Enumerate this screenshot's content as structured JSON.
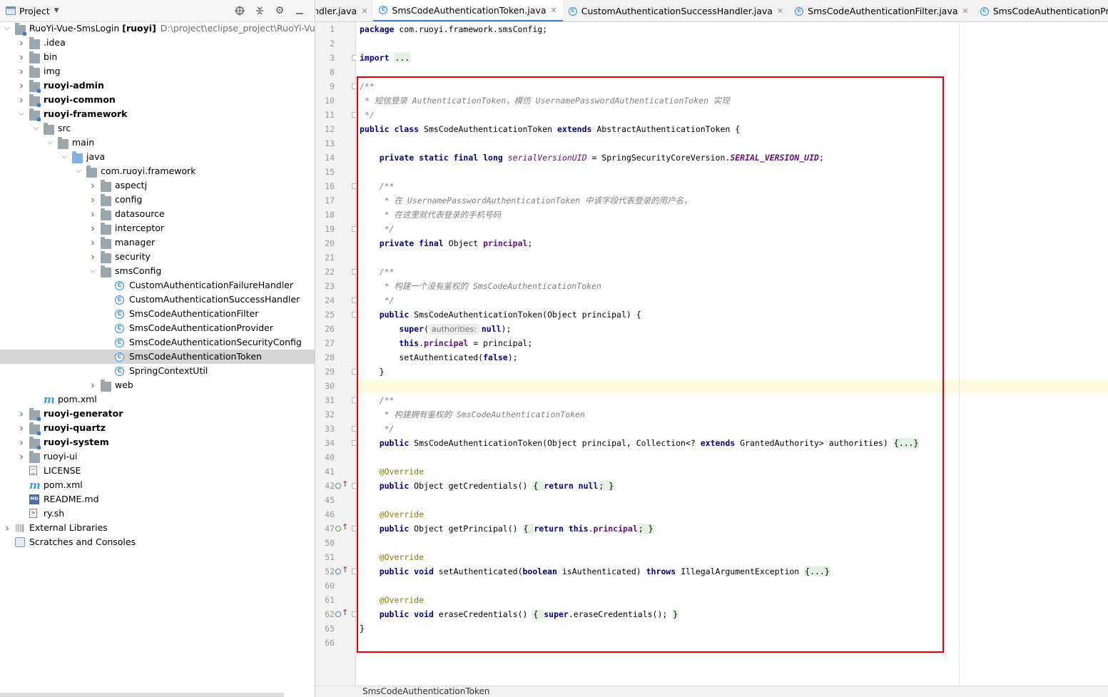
{
  "project_panel": {
    "title": "Project",
    "tools": [
      "locate-icon",
      "collapse-icon",
      "gear-icon",
      "hide-icon"
    ]
  },
  "tree": [
    {
      "label": "RuoYi-Vue-SmsLogin [ruoyi]",
      "path": "D:\\project\\eclipse_project\\RuoYi-Vue-Sm",
      "depth": 0,
      "arrow": "down",
      "icon": "module",
      "bold": false
    },
    {
      "label": ".idea",
      "depth": 1,
      "arrow": "right",
      "icon": "folder"
    },
    {
      "label": "bin",
      "depth": 1,
      "arrow": "right",
      "icon": "folder"
    },
    {
      "label": "img",
      "depth": 1,
      "arrow": "right",
      "icon": "folder"
    },
    {
      "label": "ruoyi-admin",
      "depth": 1,
      "arrow": "right",
      "icon": "module",
      "bold": true
    },
    {
      "label": "ruoyi-common",
      "depth": 1,
      "arrow": "right",
      "icon": "module",
      "bold": true
    },
    {
      "label": "ruoyi-framework",
      "depth": 1,
      "arrow": "down",
      "icon": "module",
      "bold": true
    },
    {
      "label": "src",
      "depth": 2,
      "arrow": "down",
      "icon": "folder"
    },
    {
      "label": "main",
      "depth": 3,
      "arrow": "down",
      "icon": "folder"
    },
    {
      "label": "java",
      "depth": 4,
      "arrow": "down",
      "icon": "folder-blue"
    },
    {
      "label": "com.ruoyi.framework",
      "depth": 5,
      "arrow": "down",
      "icon": "folder"
    },
    {
      "label": "aspectj",
      "depth": 6,
      "arrow": "right",
      "icon": "folder"
    },
    {
      "label": "config",
      "depth": 6,
      "arrow": "right",
      "icon": "folder"
    },
    {
      "label": "datasource",
      "depth": 6,
      "arrow": "right",
      "icon": "folder"
    },
    {
      "label": "interceptor",
      "depth": 6,
      "arrow": "right",
      "icon": "folder"
    },
    {
      "label": "manager",
      "depth": 6,
      "arrow": "right",
      "icon": "folder"
    },
    {
      "label": "security",
      "depth": 6,
      "arrow": "right",
      "icon": "folder"
    },
    {
      "label": "smsConfig",
      "depth": 6,
      "arrow": "down",
      "icon": "folder"
    },
    {
      "label": "CustomAuthenticationFailureHandler",
      "depth": 7,
      "arrow": "",
      "icon": "class"
    },
    {
      "label": "CustomAuthenticationSuccessHandler",
      "depth": 7,
      "arrow": "",
      "icon": "class"
    },
    {
      "label": "SmsCodeAuthenticationFilter",
      "depth": 7,
      "arrow": "",
      "icon": "class"
    },
    {
      "label": "SmsCodeAuthenticationProvider",
      "depth": 7,
      "arrow": "",
      "icon": "class"
    },
    {
      "label": "SmsCodeAuthenticationSecurityConfig",
      "depth": 7,
      "arrow": "",
      "icon": "class"
    },
    {
      "label": "SmsCodeAuthenticationToken",
      "depth": 7,
      "arrow": "",
      "icon": "class",
      "selected": true
    },
    {
      "label": "SpringContextUtil",
      "depth": 7,
      "arrow": "",
      "icon": "class"
    },
    {
      "label": "web",
      "depth": 6,
      "arrow": "right",
      "icon": "folder"
    },
    {
      "label": "pom.xml",
      "depth": 2,
      "arrow": "",
      "icon": "maven"
    },
    {
      "label": "ruoyi-generator",
      "depth": 1,
      "arrow": "right",
      "icon": "module",
      "bold": true
    },
    {
      "label": "ruoyi-quartz",
      "depth": 1,
      "arrow": "right",
      "icon": "module",
      "bold": true
    },
    {
      "label": "ruoyi-system",
      "depth": 1,
      "arrow": "right",
      "icon": "module",
      "bold": true
    },
    {
      "label": "ruoyi-ui",
      "depth": 1,
      "arrow": "right",
      "icon": "folder"
    },
    {
      "label": "LICENSE",
      "depth": 1,
      "arrow": "",
      "icon": "file"
    },
    {
      "label": "pom.xml",
      "depth": 1,
      "arrow": "",
      "icon": "maven"
    },
    {
      "label": "README.md",
      "depth": 1,
      "arrow": "",
      "icon": "md"
    },
    {
      "label": "ry.sh",
      "depth": 1,
      "arrow": "",
      "icon": "sh"
    },
    {
      "label": "External Libraries",
      "depth": 0,
      "arrow": "right",
      "icon": "library"
    },
    {
      "label": "Scratches and Consoles",
      "depth": 0,
      "arrow": "",
      "icon": "scratch"
    }
  ],
  "tabs": [
    {
      "label": "ndler.java",
      "partial": true,
      "icon": false
    },
    {
      "label": "SmsCodeAuthenticationToken.java",
      "active": true,
      "icon": true
    },
    {
      "label": "CustomAuthenticationSuccessHandler.java",
      "icon": true
    },
    {
      "label": "SmsCodeAuthenticationFilter.java",
      "icon": true
    },
    {
      "label": "SmsCodeAuthenticationProvider.java",
      "icon": true,
      "noclose": true
    }
  ],
  "code_lines": [
    {
      "n": "1",
      "tokens": [
        [
          "k",
          "package"
        ],
        [
          "t",
          " com.ruoyi.framework.smsConfig;"
        ]
      ]
    },
    {
      "n": "2",
      "tokens": []
    },
    {
      "n": "3",
      "fold": true,
      "tokens": [
        [
          "k",
          "import"
        ],
        [
          "t",
          " "
        ],
        [
          "fd",
          "..."
        ]
      ]
    },
    {
      "n": "8",
      "tokens": []
    },
    {
      "n": "9",
      "fold": true,
      "tokens": [
        [
          "c",
          "/**"
        ]
      ]
    },
    {
      "n": "10",
      "tokens": [
        [
          "c",
          " * 短信登录 AuthenticationToken，模仿 UsernamePasswordAuthenticationToken 实现"
        ]
      ]
    },
    {
      "n": "11",
      "fold": true,
      "tokens": [
        [
          "c",
          " */"
        ]
      ]
    },
    {
      "n": "12",
      "tokens": [
        [
          "k",
          "public class"
        ],
        [
          "t",
          " SmsCodeAuthenticationToken "
        ],
        [
          "k",
          "extends"
        ],
        [
          "t",
          " AbstractAuthenticationToken {"
        ]
      ]
    },
    {
      "n": "13",
      "tokens": []
    },
    {
      "n": "14",
      "tokens": [
        [
          "t",
          "    "
        ],
        [
          "k",
          "private static final long"
        ],
        [
          "t",
          " "
        ],
        [
          "fi",
          "serialVersionUID"
        ],
        [
          "t",
          " = SpringSecurityCoreVersion."
        ],
        [
          "sf",
          "SERIAL_VERSION_UID"
        ],
        [
          "t",
          ";"
        ]
      ]
    },
    {
      "n": "15",
      "tokens": []
    },
    {
      "n": "16",
      "fold": true,
      "tokens": [
        [
          "t",
          "    "
        ],
        [
          "c",
          "/**"
        ]
      ]
    },
    {
      "n": "17",
      "tokens": [
        [
          "t",
          "     "
        ],
        [
          "c",
          "* 在 UsernamePasswordAuthenticationToken 中该字段代表登录的用户名，"
        ]
      ]
    },
    {
      "n": "18",
      "tokens": [
        [
          "t",
          "     "
        ],
        [
          "c",
          "* 在这里就代表登录的手机号码"
        ]
      ]
    },
    {
      "n": "19",
      "fold": true,
      "tokens": [
        [
          "t",
          "     "
        ],
        [
          "c",
          "*/"
        ]
      ]
    },
    {
      "n": "20",
      "tokens": [
        [
          "t",
          "    "
        ],
        [
          "k",
          "private final"
        ],
        [
          "t",
          " Object "
        ],
        [
          "f",
          "principal"
        ],
        [
          "t",
          ";"
        ]
      ]
    },
    {
      "n": "21",
      "tokens": []
    },
    {
      "n": "22",
      "fold": true,
      "tokens": [
        [
          "t",
          "    "
        ],
        [
          "c",
          "/**"
        ]
      ]
    },
    {
      "n": "23",
      "tokens": [
        [
          "t",
          "     "
        ],
        [
          "c",
          "* 构建一个没有鉴权的 SmsCodeAuthenticationToken"
        ]
      ]
    },
    {
      "n": "24",
      "fold": true,
      "tokens": [
        [
          "t",
          "     "
        ],
        [
          "c",
          "*/"
        ]
      ]
    },
    {
      "n": "25",
      "fold": true,
      "tokens": [
        [
          "t",
          "    "
        ],
        [
          "k",
          "public"
        ],
        [
          "t",
          " SmsCodeAuthenticationToken(Object principal) {"
        ]
      ]
    },
    {
      "n": "26",
      "tokens": [
        [
          "t",
          "        "
        ],
        [
          "k",
          "super"
        ],
        [
          "t",
          "("
        ],
        [
          "hint",
          "authorities:"
        ],
        [
          "k",
          "null"
        ],
        [
          "t",
          ");"
        ]
      ]
    },
    {
      "n": "27",
      "tokens": [
        [
          "t",
          "        "
        ],
        [
          "k",
          "this"
        ],
        [
          "t",
          "."
        ],
        [
          "f",
          "principal"
        ],
        [
          "t",
          " = principal;"
        ]
      ]
    },
    {
      "n": "28",
      "tokens": [
        [
          "t",
          "        setAuthenticated("
        ],
        [
          "k",
          "false"
        ],
        [
          "t",
          ");"
        ]
      ]
    },
    {
      "n": "29",
      "fold": true,
      "tokens": [
        [
          "t",
          "    }"
        ]
      ]
    },
    {
      "n": "30",
      "current": true,
      "tokens": []
    },
    {
      "n": "31",
      "fold": true,
      "tokens": [
        [
          "t",
          "    "
        ],
        [
          "c",
          "/**"
        ]
      ]
    },
    {
      "n": "32",
      "tokens": [
        [
          "t",
          "     "
        ],
        [
          "c",
          "* 构建拥有鉴权的 SmsCodeAuthenticationToken"
        ]
      ]
    },
    {
      "n": "33",
      "fold": true,
      "tokens": [
        [
          "t",
          "     "
        ],
        [
          "c",
          "*/"
        ]
      ]
    },
    {
      "n": "34",
      "fold": true,
      "tokens": [
        [
          "t",
          "    "
        ],
        [
          "k",
          "public"
        ],
        [
          "t",
          " SmsCodeAuthenticationToken(Object principal, Collection<? "
        ],
        [
          "k",
          "extends"
        ],
        [
          "t",
          " GrantedAuthority> authorities) "
        ],
        [
          "fd",
          "{...}"
        ]
      ]
    },
    {
      "n": "40",
      "tokens": []
    },
    {
      "n": "41",
      "tokens": [
        [
          "t",
          "    "
        ],
        [
          "an",
          "@Override"
        ]
      ]
    },
    {
      "n": "42",
      "mark": "green",
      "fold": true,
      "tokens": [
        [
          "t",
          "    "
        ],
        [
          "k",
          "public"
        ],
        [
          "t",
          " Object getCredentials() "
        ],
        [
          "fd",
          "{ "
        ],
        [
          "k",
          "return null"
        ],
        [
          "fd",
          "; }"
        ]
      ]
    },
    {
      "n": "45",
      "tokens": []
    },
    {
      "n": "46",
      "tokens": [
        [
          "t",
          "    "
        ],
        [
          "an",
          "@Override"
        ]
      ]
    },
    {
      "n": "47",
      "mark": "green",
      "fold": true,
      "tokens": [
        [
          "t",
          "    "
        ],
        [
          "k",
          "public"
        ],
        [
          "t",
          " Object getPrincipal() "
        ],
        [
          "fd",
          "{ "
        ],
        [
          "k",
          "return this"
        ],
        [
          "t",
          "."
        ],
        [
          "f",
          "principal"
        ],
        [
          "fd",
          "; }"
        ]
      ]
    },
    {
      "n": "50",
      "tokens": []
    },
    {
      "n": "51",
      "tokens": [
        [
          "t",
          "    "
        ],
        [
          "an",
          "@Override"
        ]
      ]
    },
    {
      "n": "52",
      "mark": "blue",
      "fold": true,
      "tokens": [
        [
          "t",
          "    "
        ],
        [
          "k",
          "public void"
        ],
        [
          "t",
          " setAuthenticated("
        ],
        [
          "k",
          "boolean"
        ],
        [
          "t",
          " isAuthenticated) "
        ],
        [
          "k",
          "throws"
        ],
        [
          "t",
          " IllegalArgumentException "
        ],
        [
          "fd",
          "{...}"
        ]
      ]
    },
    {
      "n": "60",
      "tokens": []
    },
    {
      "n": "61",
      "tokens": [
        [
          "t",
          "    "
        ],
        [
          "an",
          "@Override"
        ]
      ]
    },
    {
      "n": "62",
      "mark": "blue",
      "fold": true,
      "tokens": [
        [
          "t",
          "    "
        ],
        [
          "k",
          "public void"
        ],
        [
          "t",
          " eraseCredentials() "
        ],
        [
          "fd",
          "{ "
        ],
        [
          "k",
          "super"
        ],
        [
          "t",
          ".eraseCredentials(); "
        ],
        [
          "fd",
          "}"
        ]
      ]
    },
    {
      "n": "65",
      "tokens": [
        [
          "t",
          "}"
        ]
      ]
    },
    {
      "n": "66",
      "tokens": []
    }
  ],
  "breadcrumb": "SmsCodeAuthenticationToken",
  "colors": {
    "highlight_box": "#e60000",
    "keyword": "#000080",
    "comment": "#808080",
    "field": "#660e7a",
    "annotation": "#808000",
    "current_line": "#fffbe3"
  }
}
